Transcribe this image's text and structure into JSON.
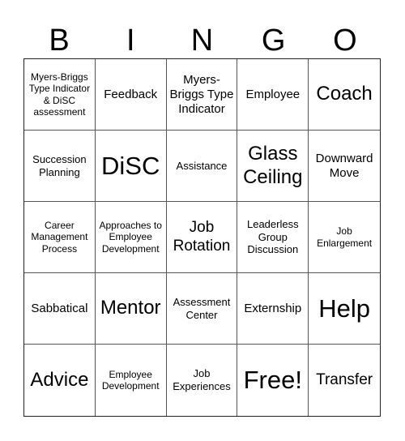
{
  "header": [
    "B",
    "I",
    "N",
    "G",
    "O"
  ],
  "cells": [
    {
      "text": "Myers-Briggs Type Indicator & DiSC assessment",
      "size": "s-xs"
    },
    {
      "text": "Feedback",
      "size": "s-md"
    },
    {
      "text": "Myers-Briggs Type Indicator",
      "size": "s-md"
    },
    {
      "text": "Employee",
      "size": "s-md"
    },
    {
      "text": "Coach",
      "size": "s-xl"
    },
    {
      "text": "Succession Planning",
      "size": "s-sm"
    },
    {
      "text": "DiSC",
      "size": "s-xxl"
    },
    {
      "text": "Assistance",
      "size": "s-sm"
    },
    {
      "text": "Glass Ceiling",
      "size": "s-xl"
    },
    {
      "text": "Downward Move",
      "size": "s-md"
    },
    {
      "text": "Career Management Process",
      "size": "s-xs"
    },
    {
      "text": "Approaches to Employee Development",
      "size": "s-xs"
    },
    {
      "text": "Job Rotation",
      "size": "s-lg"
    },
    {
      "text": "Leaderless Group Discussion",
      "size": "s-sm"
    },
    {
      "text": "Job Enlargement",
      "size": "s-xs"
    },
    {
      "text": "Sabbatical",
      "size": "s-md"
    },
    {
      "text": "Mentor",
      "size": "s-xl"
    },
    {
      "text": "Assessment Center",
      "size": "s-sm"
    },
    {
      "text": "Externship",
      "size": "s-md"
    },
    {
      "text": "Help",
      "size": "s-xxl"
    },
    {
      "text": "Advice",
      "size": "s-xl"
    },
    {
      "text": "Employee Development",
      "size": "s-xs"
    },
    {
      "text": "Job Experiences",
      "size": "s-sm"
    },
    {
      "text": "Free!",
      "size": "s-xxl"
    },
    {
      "text": "Transfer",
      "size": "s-lg"
    }
  ]
}
